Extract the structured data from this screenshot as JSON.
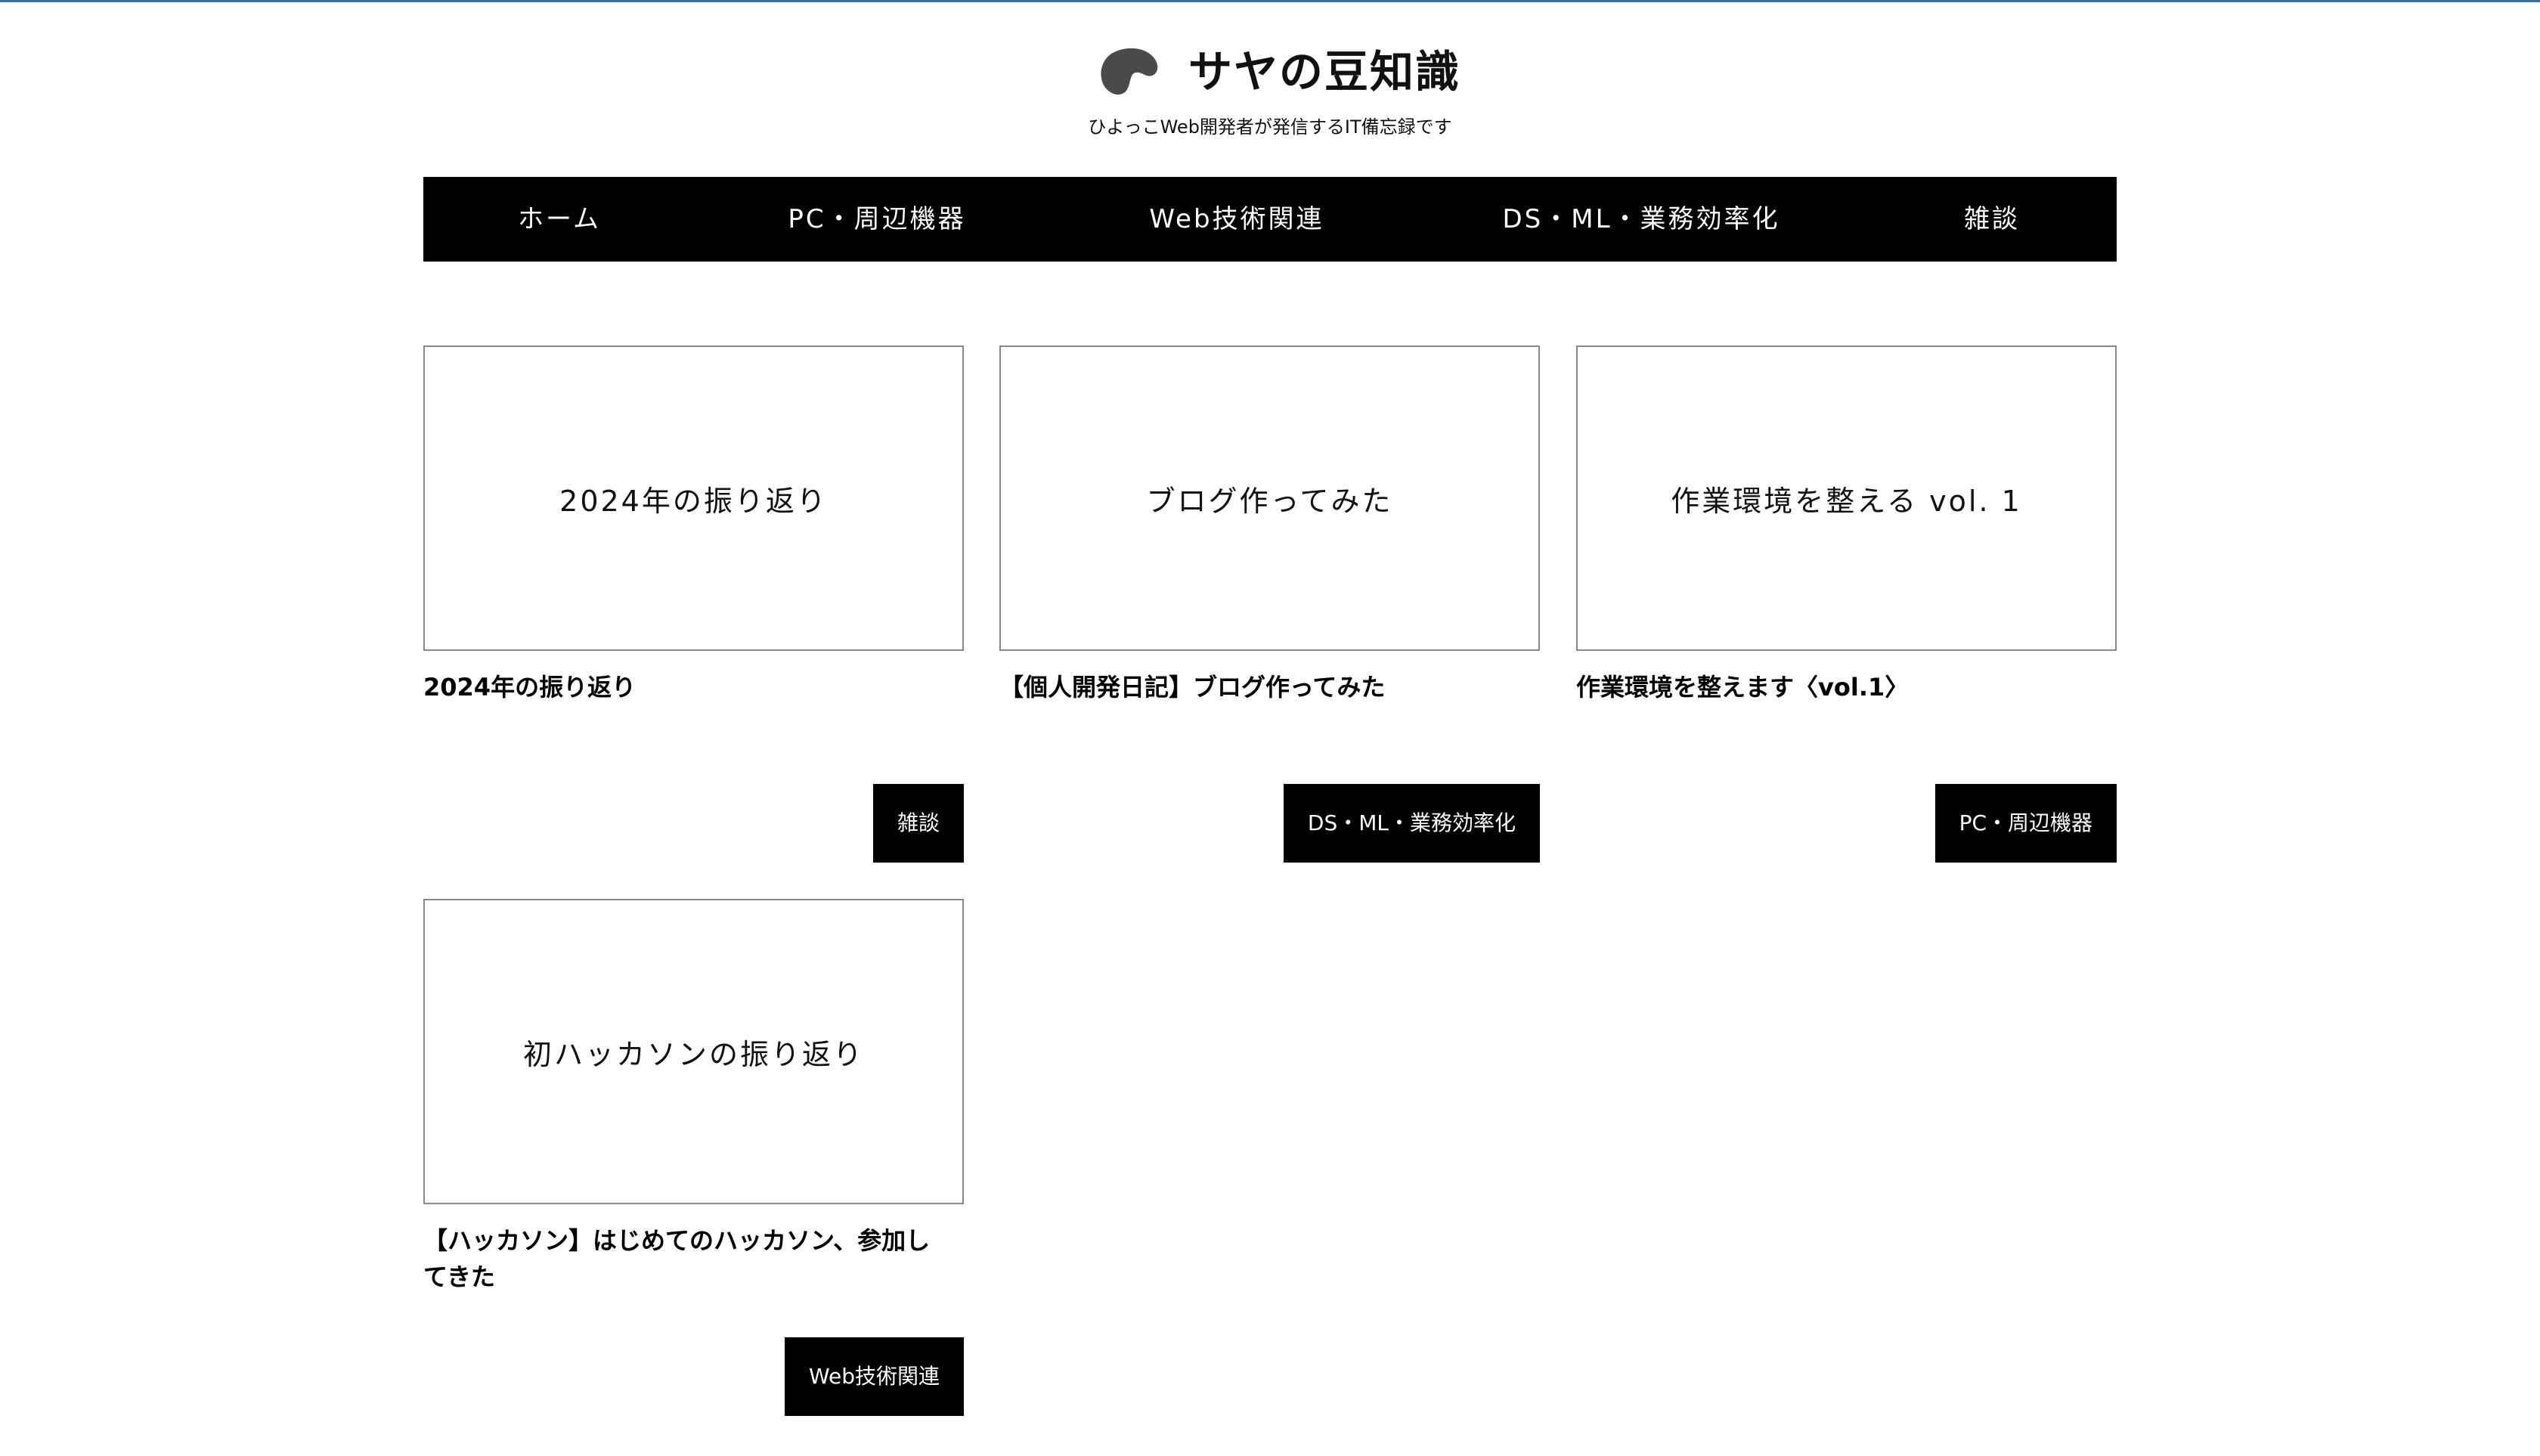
{
  "header": {
    "title": "サヤの豆知識",
    "tagline": "ひよっこWeb開発者が発信するIT備忘録です",
    "logo_icon": "bean-logo-icon",
    "accent_color": "#3b6f96"
  },
  "nav": {
    "items": [
      {
        "label": "ホーム"
      },
      {
        "label": "PC・周辺機器"
      },
      {
        "label": "Web技術関連"
      },
      {
        "label": "DS・ML・業務効率化"
      },
      {
        "label": "雑談"
      }
    ]
  },
  "posts": [
    {
      "thumb_text": "2024年の振り返り",
      "title": "2024年の振り返り",
      "category": "雑談"
    },
    {
      "thumb_text": "ブログ作ってみた",
      "title": "【個人開発日記】ブログ作ってみた",
      "category": "DS・ML・業務効率化"
    },
    {
      "thumb_text": "作業環境を整える vol. 1",
      "title": "作業環境を整えます〈vol.1〉",
      "category": "PC・周辺機器"
    },
    {
      "thumb_text": "初ハッカソンの振り返り",
      "title": "【ハッカソン】はじめてのハッカソン、参加してきた",
      "category": "Web技術関連"
    }
  ]
}
